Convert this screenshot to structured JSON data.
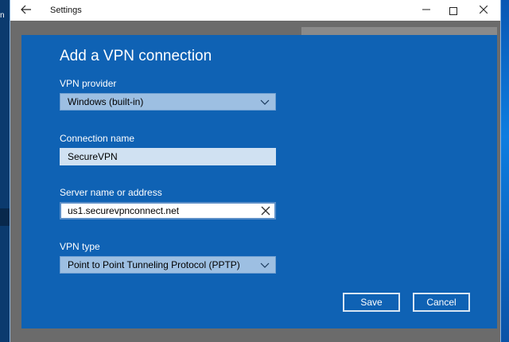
{
  "window": {
    "title": "Settings",
    "back_icon": "back-arrow-icon",
    "minimize_icon": "minimize-icon",
    "maximize_icon": "maximize-icon",
    "close_icon": "close-icon"
  },
  "desktop": {
    "left_fragment": "n"
  },
  "dialog": {
    "title": "Add a VPN connection",
    "vpn_provider": {
      "label": "VPN provider",
      "value": "Windows (built-in)"
    },
    "connection_name": {
      "label": "Connection name",
      "value": "SecureVPN"
    },
    "server": {
      "label": "Server name or address",
      "value": "us1.securevpnconnect.net"
    },
    "vpn_type": {
      "label": "VPN type",
      "value": "Point to Point Tunneling Protocol (PPTP)"
    },
    "save_label": "Save",
    "cancel_label": "Cancel"
  },
  "colors": {
    "dialog_bg": "#0f62b4",
    "select_bg": "#9dbfe2",
    "textbox_bg": "#d0e1f2",
    "overlay": "#6b6b6b"
  }
}
